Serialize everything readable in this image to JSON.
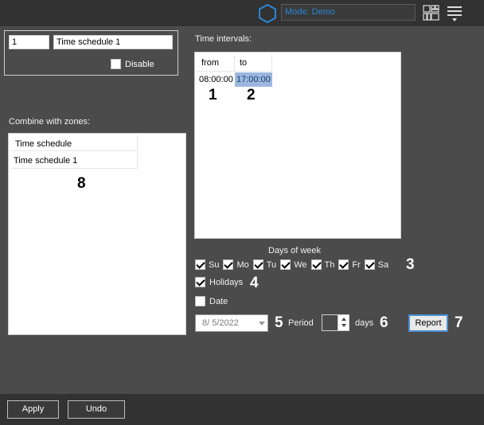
{
  "topbar": {
    "mode_label": "Mode: Demo",
    "icons": [
      "hexagon-icon",
      "layout-grid-icon",
      "hamburger-menu-icon"
    ],
    "accent_color": "#2b86d6"
  },
  "schedule": {
    "id": "1",
    "name": "Time schedule 1",
    "disable_label": "Disable",
    "disable_checked": false
  },
  "zones": {
    "label": "Combine with zones:",
    "column_header": "Time schedule",
    "rows": [
      "Time schedule 1"
    ],
    "callout": "8"
  },
  "intervals": {
    "label": "Time intervals:",
    "columns": [
      "from",
      "to"
    ],
    "rows": [
      {
        "from": "08:00:00",
        "to": "17:00:00"
      }
    ],
    "callouts": [
      "1",
      "2"
    ]
  },
  "days": {
    "label": "Days of week",
    "items": [
      {
        "label": "Su",
        "checked": true
      },
      {
        "label": "Mo",
        "checked": true
      },
      {
        "label": "Tu",
        "checked": true
      },
      {
        "label": "We",
        "checked": true
      },
      {
        "label": "Th",
        "checked": true
      },
      {
        "label": "Fr",
        "checked": true
      },
      {
        "label": "Sa",
        "checked": true
      }
    ],
    "callout": "3"
  },
  "holidays": {
    "label": "Holidays",
    "checked": true,
    "callout": "4"
  },
  "date": {
    "label": "Date",
    "checked": false,
    "value": "8/ 5/2022",
    "callout": "5"
  },
  "period": {
    "label": "Period",
    "value": "",
    "unit": "days",
    "callout": "6"
  },
  "report": {
    "label": "Report",
    "callout": "7"
  },
  "footer": {
    "apply_label": "Apply",
    "undo_label": "Undo"
  }
}
